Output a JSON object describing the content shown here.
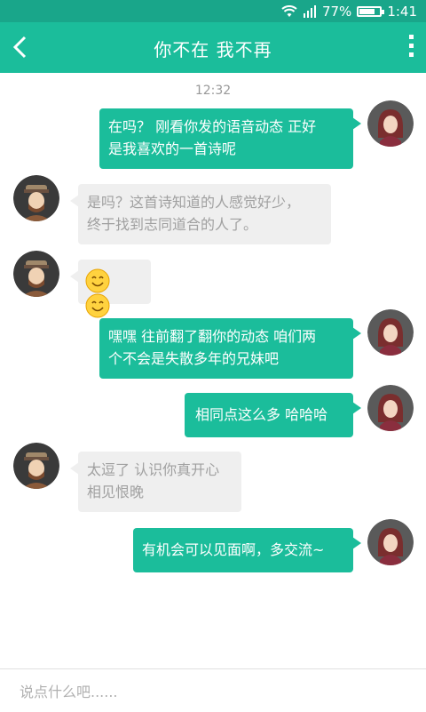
{
  "status_bar": {
    "battery_percent": "77%",
    "time": "1:41",
    "network": "4G",
    "battery_level": 0.77
  },
  "header": {
    "title": "你不在  我不再",
    "back_icon": "chevron-left-icon",
    "more_icon": "vertical-dots-icon"
  },
  "chat": {
    "timestamp": "12:32",
    "messages": [
      {
        "side": "out",
        "lines": [
          "在吗？ 刚看你发的语音动态 正好",
          "是我喜欢的一首诗呢"
        ]
      },
      {
        "side": "in",
        "lines": [
          "是吗？这首诗知道的人感觉好少，",
          "终于找到志同道合的人了。"
        ]
      },
      {
        "side": "in",
        "emoji": [
          "smile-emoji",
          "smile-emoji"
        ]
      },
      {
        "side": "out",
        "lines": [
          "嘿嘿 往前翻了翻你的动态 咱们两",
          "个不会是失散多年的兄妹吧"
        ]
      },
      {
        "side": "out",
        "lines": [
          "相同点这么多 哈哈哈"
        ]
      },
      {
        "side": "in",
        "lines": [
          "太逗了 认识你真开心",
          "相见恨晚"
        ]
      },
      {
        "side": "out",
        "lines": [
          "有机会可以见面啊，多交流~"
        ]
      }
    ]
  },
  "input": {
    "placeholder": "说点什么吧......"
  },
  "colors": {
    "status_bar": "#19a68a",
    "header": "#1bbd9b",
    "outgoing_bubble": "#1bbd9b",
    "incoming_bubble": "#efefef"
  }
}
